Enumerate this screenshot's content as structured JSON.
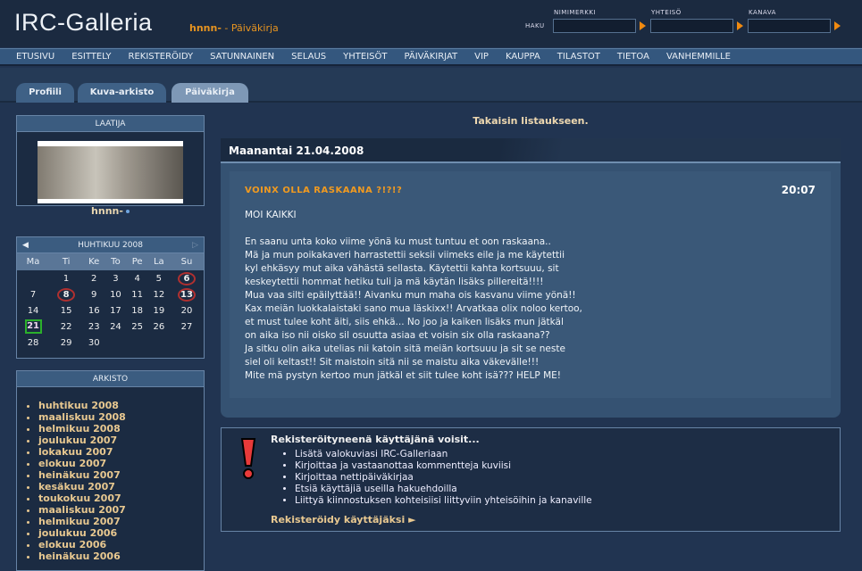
{
  "header": {
    "logo": "IRC-Galleria",
    "user": "hnnn-",
    "section": " - Päiväkirja",
    "search_label": "HAKU",
    "search_fields": [
      {
        "label": "NIMIMERKKI",
        "value": ""
      },
      {
        "label": "YHTEISÖ",
        "value": ""
      },
      {
        "label": "KANAVA",
        "value": ""
      }
    ]
  },
  "nav": [
    "ETUSIVU",
    "ESITTELY",
    "REKISTERÖIDY",
    "SATUNNAINEN",
    "SELAUS",
    "YHTEISÖT",
    "PÄIVÄKIRJAT",
    "VIP",
    "KAUPPA",
    "TILASTOT",
    "TIETOA",
    "VANHEMMILLE"
  ],
  "tabs": [
    "Profiili",
    "Kuva-arkisto",
    "Päiväkirja"
  ],
  "author": {
    "heading": "LAATIJA",
    "name": "hnnn-"
  },
  "calendar": {
    "title": "HUHTIKUU 2008",
    "days": [
      "Ma",
      "Ti",
      "Ke",
      "To",
      "Pe",
      "La",
      "Su"
    ],
    "weeks": [
      [
        "",
        "1",
        "2",
        "3",
        "4",
        "5",
        "6"
      ],
      [
        "7",
        "8",
        "9",
        "10",
        "11",
        "12",
        "13"
      ],
      [
        "14",
        "15",
        "16",
        "17",
        "18",
        "19",
        "20"
      ],
      [
        "21",
        "22",
        "23",
        "24",
        "25",
        "26",
        "27"
      ],
      [
        "28",
        "29",
        "30",
        "",
        "",
        "",
        ""
      ]
    ],
    "marked": [
      "6",
      "8",
      "13"
    ],
    "today": "21"
  },
  "archive": {
    "heading": "ARKISTO",
    "items": [
      "huhtikuu 2008",
      "maaliskuu 2008",
      "helmikuu 2008",
      "joulukuu 2007",
      "lokakuu 2007",
      "elokuu 2007",
      "heinäkuu 2007",
      "kesäkuu 2007",
      "toukokuu 2007",
      "maaliskuu 2007",
      "helmikuu 2007",
      "joulukuu 2006",
      "elokuu 2006",
      "heinäkuu 2006"
    ]
  },
  "main": {
    "back": "Takaisin listaukseen.",
    "date": "Maanantai 21.04.2008",
    "entry": {
      "title": "VOINX OLLA RASKAANA ?!?!?",
      "time": "20:07",
      "body": "MOI KAIKKI\n\nEn saanu unta koko viime yönä ku must tuntuu et oon raskaana..\nMä ja mun poikakaveri harrastettii seksii viimeks eile ja me käytettii\nkyl ehkäsyy mut aika vähästä sellasta. Käytettii kahta kortsuuu, sit\nkeskeytettii hommat hetiku tuli ja mä käytän lisäks pillereitä!!!!\nMua vaa silti epäilyttää!! Aivanku mun maha ois kasvanu viime yönä!!\nKax meiän luokkalaistaki sano mua läskixx!! Arvatkaa olix noloo kertoo,\net must tulee koht äiti, siis ehkä... No joo ja kaiken lisäks mun jätkäl\non aika iso nii oisko sil osuutta asiaa et voisin six olla raskaana??\nJa sitku olin aika utelias nii katoin sitä meiän kortsuuu ja sit se neste\nsiel oli keltast!! Sit maistoin sitä nii se maistu aika väkevälle!!!\nMite mä pystyn kertoo mun jätkäl et siit tulee koht isä??? HELP ME!"
    }
  },
  "register": {
    "title": "Rekisteröityneenä käyttäjänä voisit...",
    "items": [
      "Lisätä valokuviasi IRC-Galleriaan",
      "Kirjoittaa ja vastaanottaa kommentteja kuviisi",
      "Kirjoittaa nettipäiväkirjaa",
      "Etsiä käyttäjiä useilla hakuehdoilla",
      "Liittyä kiinnostuksen kohteisiisi liittyviin yhteisöihin ja kanaville"
    ],
    "link": "Rekisteröidy käyttäjäksi ►"
  }
}
